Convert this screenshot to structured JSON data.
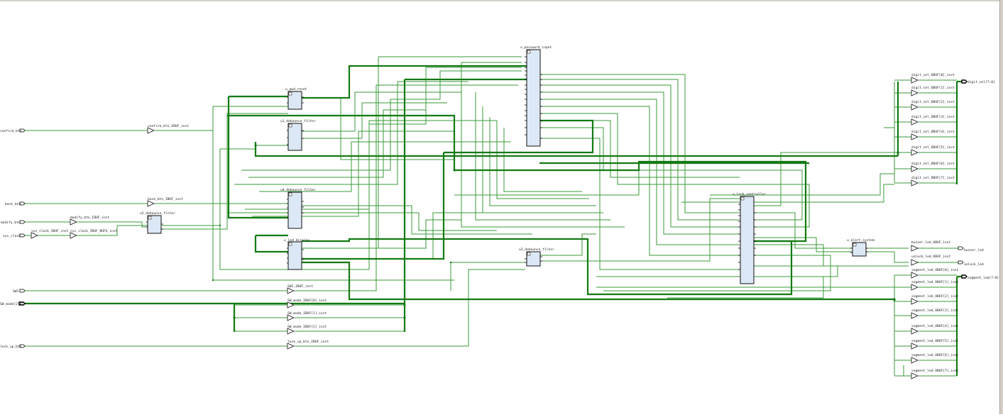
{
  "ports": {
    "confirm_btn": "confirm_btn",
    "back_btn": "back_btn",
    "modify_btn": "modify_btn",
    "sys_clock": "sys_clock",
    "SW1": "SW1",
    "SW_mode": "SW_mode[2:0]",
    "lock_up_btn": "lock_up_btn",
    "digit_sel": "digit_sel[7:0]",
    "buzzer_led": "buzzer_led",
    "unlock_led": "unlock_led",
    "segment_led": "segment_led[7:0]"
  },
  "cells": {
    "password_input": "u_password_input",
    "pwd_reset": "u_pwd_reset",
    "debounce_1": "u1_debounce_filter",
    "debounce_4": "u4_debounce_filter",
    "debounce_2": "u2_debounce_filter",
    "debounce_3": "u3_debounce_filter",
    "led_display": "u_led_display",
    "lock_controller": "u_lock_controller",
    "alert_system": "u_alert_system"
  },
  "buffers": {
    "confirm": "confirm_btn_IBUF_inst",
    "back": "back_btn_IBUF_inst",
    "modify": "modify_btn_IBUF_inst",
    "sysclk_ibuf": "sys_clock_IBUF_inst",
    "sysclk_bufg": "sys_clock_IBUF_BUFG_inst",
    "sw1": "SW1_IBUF_inst",
    "sw_mode": [
      "SW_mode_IBUF[0]_inst",
      "SW_mode_IBUF[1]_inst",
      "SW_mode_IBUF[2]_inst"
    ],
    "lock_up": "lock_up_btn_IBUF_inst",
    "digit_sel": [
      "digit_sel_OBUF[0]_inst",
      "digit_sel_OBUF[1]_inst",
      "digit_sel_OBUF[2]_inst",
      "digit_sel_OBUF[3]_inst",
      "digit_sel_OBUF[4]_inst",
      "digit_sel_OBUF[5]_inst",
      "digit_sel_OBUF[6]_inst",
      "digit_sel_OBUF[7]_inst"
    ],
    "buzzer": "buzzer_led_OBUF_inst",
    "unlock": "unlock_led_OBUF_inst",
    "segment": [
      "segment_led_OBUF[0]_inst",
      "segment_led_OBUF[1]_inst",
      "segment_led_OBUF[2]_inst",
      "segment_led_OBUF[3]_inst",
      "segment_led_OBUF[4]_inst",
      "segment_led_OBUF[5]_inst",
      "segment_led_OBUF[6]_inst",
      "segment_led_OBUF[7]_inst"
    ]
  },
  "colors": {
    "wire": "#3a9a3a",
    "bus": "#137a13",
    "cell_fill": "#dce8f5",
    "background": "#ffffff"
  }
}
